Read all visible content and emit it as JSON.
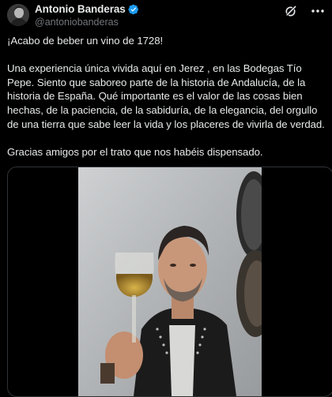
{
  "author": {
    "display_name": "Antonio Banderas",
    "handle": "@antoniobanderas",
    "verified": true
  },
  "header_icons": [
    "grok-icon",
    "more-options-icon"
  ],
  "tweet": {
    "paragraphs": [
      "¡Acabo de beber un vino de 1728!",
      "Una experiencia única vivida aquí en Jerez , en las Bodegas Tío Pepe. Siento que saboreo parte de la historia de Andalucía, de la historia de España. Qué importante es el valor de las cosas bien hechas, de la paciencia, de la sabiduría, de la elegancia, del orgullo de una tierra que sabe leer la vida y los placeres de vivirla de verdad.",
      "Gracias amigos por el trato que nos habéis dispensado."
    ]
  },
  "media": {
    "type": "video"
  },
  "colors": {
    "background": "#000000",
    "text": "#e7e9ea",
    "secondary_text": "#71767b",
    "verified_badge": "#1d9bf0",
    "border": "#2f3336"
  }
}
